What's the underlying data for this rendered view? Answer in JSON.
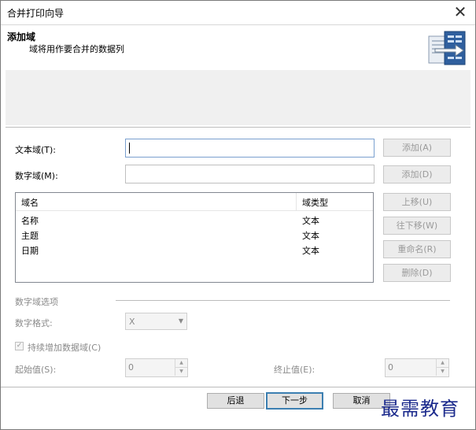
{
  "window": {
    "title": "合并打印向导",
    "close_glyph": "✕"
  },
  "header": {
    "title": "添加域",
    "subtitle": "域将用作要合并的数据列",
    "icon": "document-merge-icon"
  },
  "fields": {
    "text_label": "文本域(T):",
    "text_value": "",
    "text_add": "添加(A)",
    "number_label": "数字域(M):",
    "number_value": "",
    "number_add": "添加(D)"
  },
  "list": {
    "col_name": "域名",
    "col_type": "域类型",
    "rows": [
      {
        "name": "名称",
        "type": "文本"
      },
      {
        "name": "主题",
        "type": "文本"
      },
      {
        "name": "日期",
        "type": "文本"
      }
    ]
  },
  "side_buttons": {
    "up": "上移(U)",
    "down": "往下移(W)",
    "rename": "重命名(R)",
    "delete": "删除(D)"
  },
  "options": {
    "group_label": "数字域选项",
    "format_label": "数字格式:",
    "format_value": "X",
    "continue_label": "持续增加数据域(C)",
    "continue_checked": true,
    "start_label": "起始值(S):",
    "start_value": "0",
    "end_label": "终止值(E):",
    "end_value": "0"
  },
  "footer": {
    "back": "后退",
    "next": "下一步",
    "cancel": "取消"
  },
  "watermark": "最需教育",
  "colors": {
    "watermark": "#1b2a8c",
    "default_button_border": "#3c7fb1",
    "disabled_text": "#8a8a8a"
  }
}
